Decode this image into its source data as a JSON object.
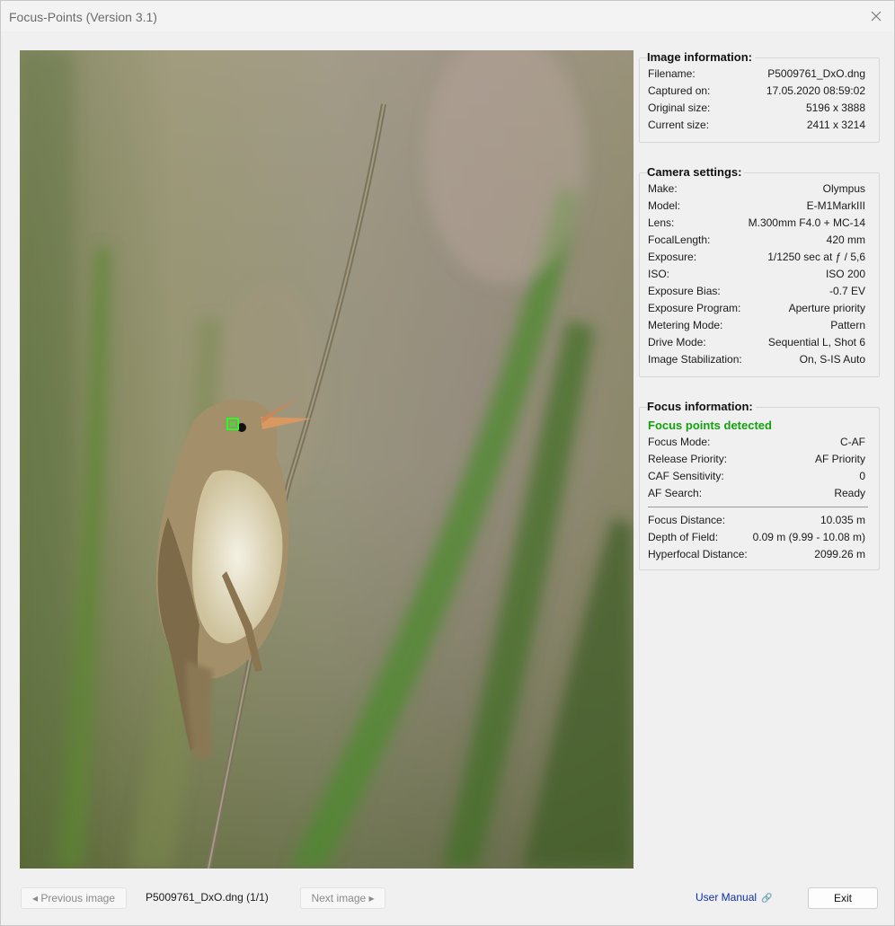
{
  "window": {
    "title": "Focus-Points (Version 3.1)",
    "close_icon": "close-icon"
  },
  "image_info": {
    "heading": "Image information:",
    "rows": [
      {
        "label": "Filename:",
        "value": "P5009761_DxO.dng"
      },
      {
        "label": "Captured on:",
        "value": "17.05.2020 08:59:02"
      },
      {
        "label": "Original size:",
        "value": "5196 x 3888"
      },
      {
        "label": "Current size:",
        "value": "2411 x 3214"
      }
    ]
  },
  "camera_settings": {
    "heading": "Camera settings:",
    "rows": [
      {
        "label": "Make:",
        "value": "Olympus"
      },
      {
        "label": "Model:",
        "value": "E-M1MarkIII"
      },
      {
        "label": "Lens:",
        "value": "M.300mm F4.0 + MC-14"
      },
      {
        "label": "FocalLength:",
        "value": "420 mm"
      },
      {
        "label": "Exposure:",
        "value": "1/1250 sec at ƒ / 5,6"
      },
      {
        "label": "ISO:",
        "value": "ISO 200"
      },
      {
        "label": "Exposure Bias:",
        "value": "-0.7 EV"
      },
      {
        "label": "Exposure Program:",
        "value": "Aperture priority"
      },
      {
        "label": "Metering Mode:",
        "value": "Pattern"
      },
      {
        "label": "Drive Mode:",
        "value": "Sequential L, Shot 6"
      },
      {
        "label": "Image Stabilization:",
        "value": "On, S-IS Auto"
      }
    ]
  },
  "focus_info": {
    "heading": "Focus information:",
    "status": "Focus points detected",
    "status_color": "#13a10e",
    "rows": [
      {
        "label": "Focus Mode:",
        "value": "C-AF"
      },
      {
        "label": "Release Priority:",
        "value": "AF Priority"
      },
      {
        "label": "CAF Sensitivity:",
        "value": "0"
      },
      {
        "label": "AF Search:",
        "value": "Ready"
      }
    ],
    "rows2": [
      {
        "label": "Focus Distance:",
        "value": "10.035 m"
      },
      {
        "label": "Depth of Field:",
        "value": "0.09 m (9.99 - 10.08 m)"
      },
      {
        "label": "Hyperfocal Distance:",
        "value": "2099.26 m"
      }
    ]
  },
  "footer": {
    "prev_label": "◂ Previous image",
    "file_label": "P5009761_DxO.dng (1/1)",
    "next_label": "Next image ▸",
    "manual_label": "User Manual",
    "manual_icon": "link-icon",
    "exit_label": "Exit"
  },
  "photo": {
    "focus_point_color": "#22ff22",
    "subject": "bird-on-reed"
  }
}
